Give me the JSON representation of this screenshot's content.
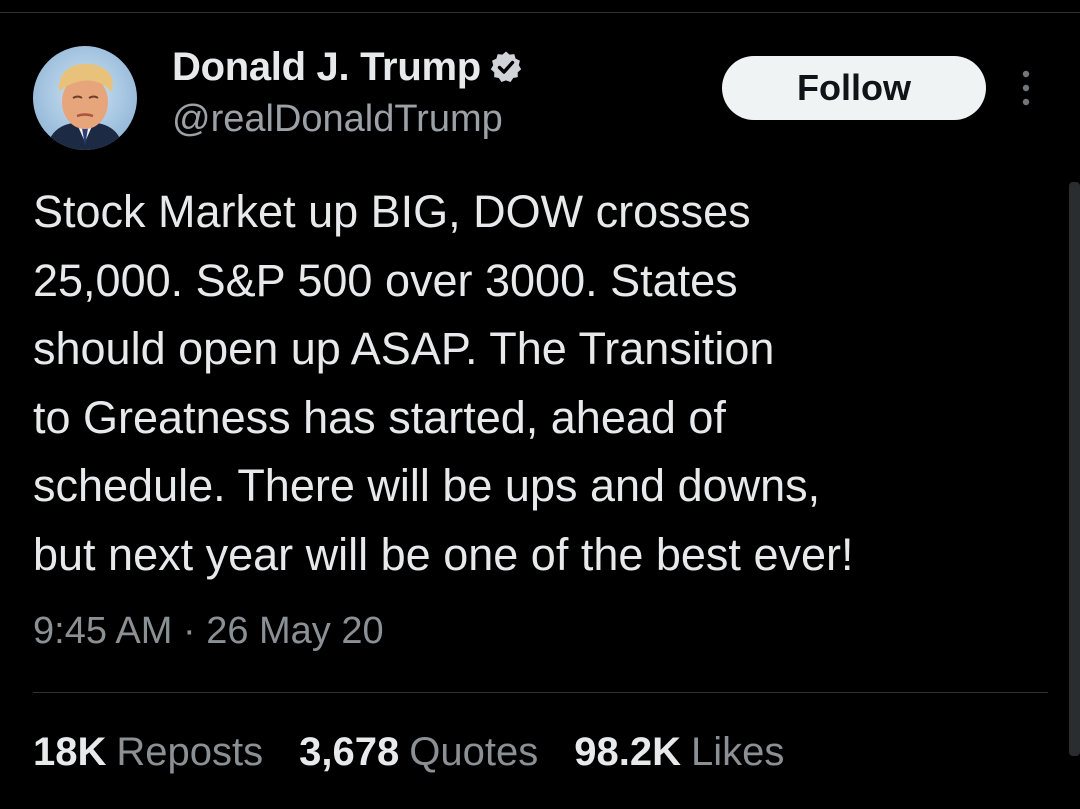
{
  "author": {
    "display_name": "Donald J. Trump",
    "handle": "@realDonaldTrump",
    "verified_icon": "verified-badge-icon",
    "verified_color": "#d0d4d8"
  },
  "actions": {
    "follow_label": "Follow",
    "more_icon": "vertical-ellipsis-icon"
  },
  "tweet": {
    "lines": [
      "Stock Market up BIG, DOW crosses",
      "25,000. S&P 500 over 3000. States",
      "should open up ASAP. The Transition",
      "to Greatness has started, ahead of",
      "schedule. There will be ups and downs,",
      "but next year will be one of the best ever!"
    ],
    "timestamp": "9:45 AM · 26 May 20"
  },
  "stats": {
    "reposts_count": "18K",
    "reposts_label": "Reposts",
    "quotes_count": "3,678",
    "quotes_label": "Quotes",
    "likes_count": "98.2K",
    "likes_label": "Likes"
  },
  "colors": {
    "background": "#000000",
    "text_primary": "#e7e9ea",
    "text_secondary": "#8b9095",
    "follow_button_bg": "#eff3f4"
  }
}
